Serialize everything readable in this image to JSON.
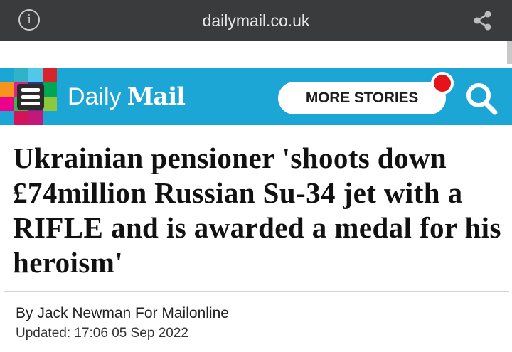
{
  "browser": {
    "url": "dailymail.co.uk",
    "info_icon_glyph": "i",
    "icons": [
      "info-icon",
      "share-icon"
    ]
  },
  "header": {
    "background": "#1ba6d6",
    "logo_daily": "Daily",
    "logo_mail": "Mail",
    "more_stories_label": "MORE STORIES",
    "notification_color": "#e5141b",
    "icons": [
      "menu-icon",
      "search-icon"
    ],
    "mosaic_colors": [
      "#1ba6d6",
      "#2fb3c9",
      "#52c8e8",
      "#d8232a",
      "#f7941d",
      "#e0218a",
      "#2e3192",
      "#00a651",
      "#ec008c",
      "#39b54a",
      "#662d91",
      "#8dc63f",
      "#1ba6d6",
      "#d4145a",
      "#c2187a",
      "#1ba6d6"
    ]
  },
  "article": {
    "headline": "Ukrainian pensioner 'shoots down £74million Russian Su-34 jet with a RIFLE and is awarded a medal for his heroism'",
    "byline": "By Jack Newman For Mailonline",
    "updated": "Updated: 17:06 05 Sep 2022"
  }
}
